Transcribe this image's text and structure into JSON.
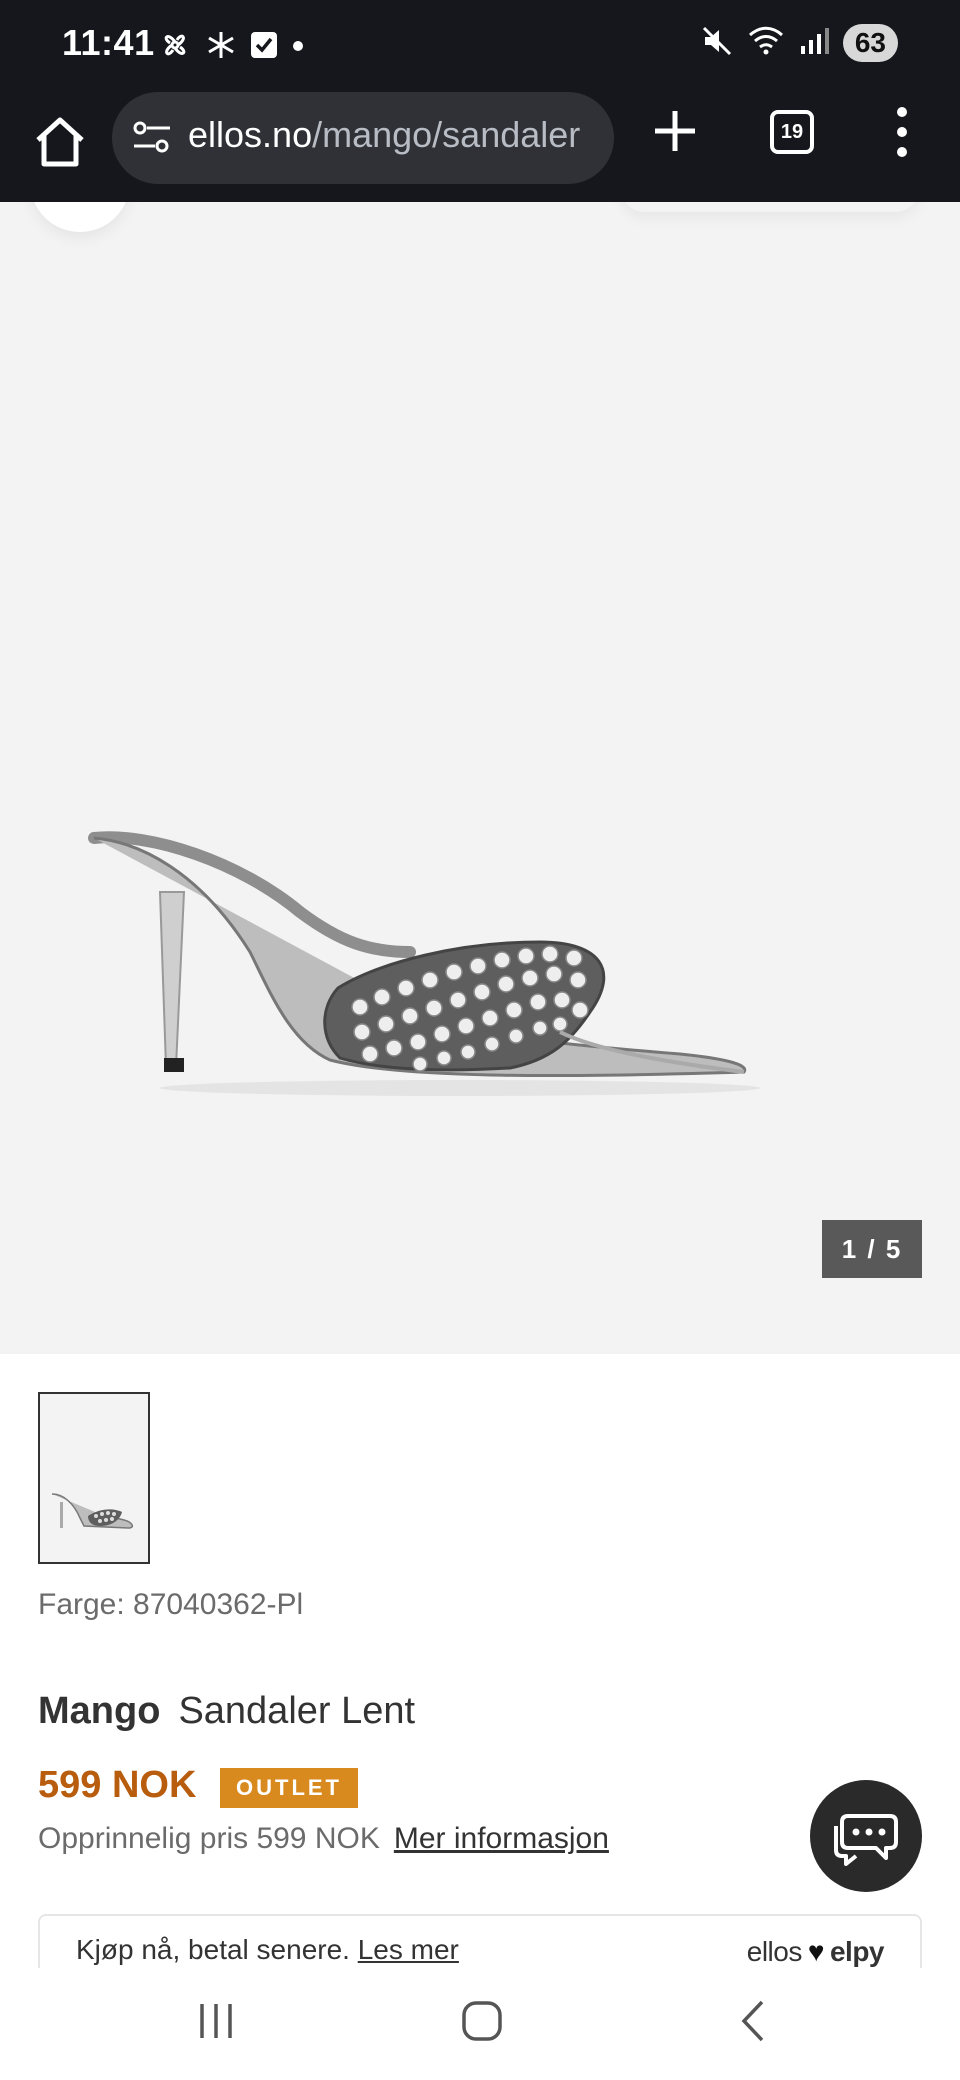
{
  "status": {
    "time": "11:41",
    "battery": "63"
  },
  "browser": {
    "url_domain": "ellos.no",
    "url_path": "/mango/sandaler",
    "tab_count": "19"
  },
  "gallery": {
    "counter": "1 / 5"
  },
  "product": {
    "color_label": "Farge: 87040362-Pl",
    "brand": "Mango",
    "name": "Sandaler Lent",
    "price": "599 NOK",
    "badge": "OUTLET",
    "original_price": "Opprinnelig pris 599 NOK",
    "more_info": "Mer informasjon"
  },
  "payment": {
    "text": "Kjøp nå, betal senere.",
    "link": "Les mer",
    "logo_left": "ellos",
    "logo_right": "elpy"
  },
  "colors": {
    "price": "#b85c0d",
    "badge": "#d98a1e",
    "statusbar": "#15171c"
  }
}
